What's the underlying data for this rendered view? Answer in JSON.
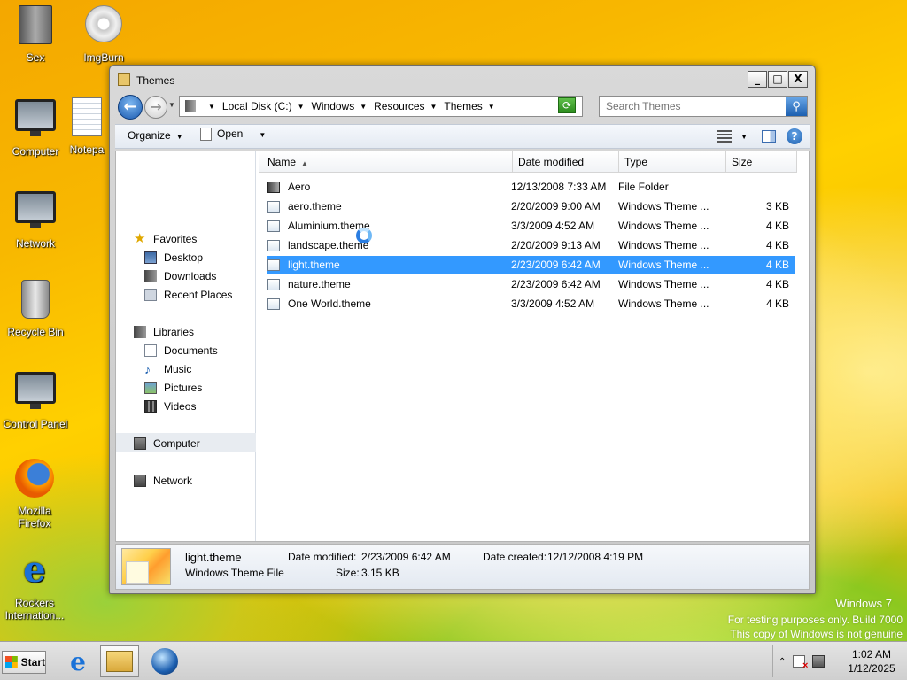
{
  "desktop": {
    "icons": [
      {
        "label": "Sex",
        "icon": "folder-icon"
      },
      {
        "label": "ImgBurn",
        "icon": "disc-icon"
      },
      {
        "label": "Computer",
        "icon": "computer-icon"
      },
      {
        "label": "Notepa",
        "icon": "notepad-icon"
      },
      {
        "label": "Network",
        "icon": "network-icon"
      },
      {
        "label": "Recycle Bin",
        "icon": "recycle-bin-icon"
      },
      {
        "label": "Control Panel",
        "icon": "control-panel-icon"
      },
      {
        "label": "Mozilla Firefox",
        "icon": "firefox-icon"
      },
      {
        "label": "Rockers Internation...",
        "icon": "ie-icon"
      }
    ],
    "watermark": {
      "line1": "Windows 7",
      "line2": "For testing purposes only. Build 7000",
      "line3": "This copy of Windows is not genuine"
    }
  },
  "window": {
    "title": "Themes",
    "controls": {
      "minimize": "_",
      "maximize": "□",
      "close": "X"
    },
    "breadcrumb": [
      "Local Disk (C:)",
      "Windows",
      "Resources",
      "Themes"
    ],
    "search_placeholder": "Search Themes",
    "toolbar": {
      "organize": "Organize",
      "open": "Open"
    },
    "nav": {
      "favorites": "Favorites",
      "desktop": "Desktop",
      "downloads": "Downloads",
      "recent": "Recent Places",
      "libraries": "Libraries",
      "documents": "Documents",
      "music": "Music",
      "pictures": "Pictures",
      "videos": "Videos",
      "computer": "Computer",
      "network": "Network"
    },
    "columns": {
      "name": "Name",
      "date": "Date modified",
      "type": "Type",
      "size": "Size"
    },
    "files": [
      {
        "name": "Aero",
        "date": "12/13/2008 7:33 AM",
        "type": "File Folder",
        "size": ""
      },
      {
        "name": "aero.theme",
        "date": "2/20/2009 9:00 AM",
        "type": "Windows Theme ...",
        "size": "3 KB"
      },
      {
        "name": "Aluminium.theme",
        "date": "3/3/2009 4:52 AM",
        "type": "Windows Theme ...",
        "size": "4 KB"
      },
      {
        "name": "landscape.theme",
        "date": "2/20/2009 9:13 AM",
        "type": "Windows Theme ...",
        "size": "4 KB"
      },
      {
        "name": "light.theme",
        "date": "2/23/2009 6:42 AM",
        "type": "Windows Theme ...",
        "size": "4 KB"
      },
      {
        "name": "nature.theme",
        "date": "2/23/2009 6:42 AM",
        "type": "Windows Theme ...",
        "size": "4 KB"
      },
      {
        "name": "One World.theme",
        "date": "3/3/2009 4:52 AM",
        "type": "Windows Theme ...",
        "size": "4 KB"
      }
    ],
    "selected_index": 4,
    "details": {
      "filename": "light.theme",
      "filetype": "Windows Theme File",
      "modified_label": "Date modified:",
      "modified_value": "2/23/2009 6:42 AM",
      "created_label": "Date created:",
      "created_value": "12/12/2008 4:19 PM",
      "size_label": "Size:",
      "size_value": "3.15 KB"
    }
  },
  "taskbar": {
    "start_label": "Start",
    "clock_time": "1:02 AM",
    "clock_date": "1/12/2025"
  },
  "colors": {
    "selection": "#3399ff",
    "accent": "#1c5fb0"
  }
}
